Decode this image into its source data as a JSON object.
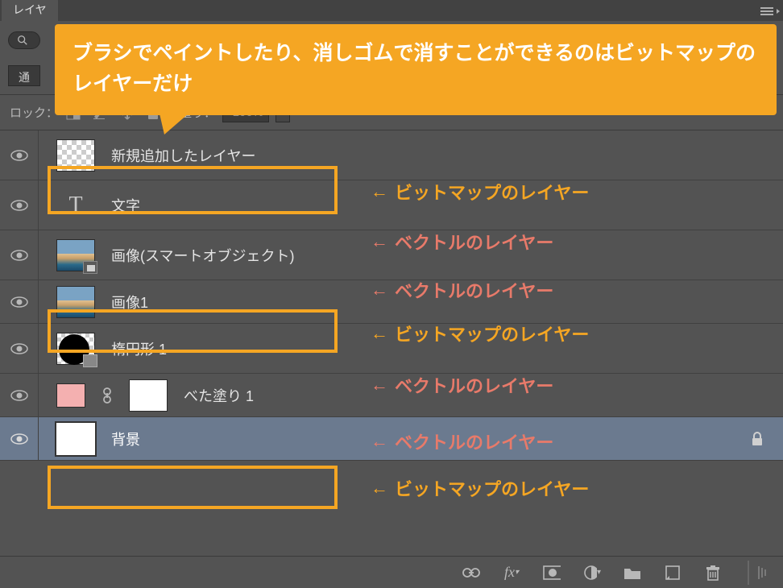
{
  "panel": {
    "tab": "レイヤ"
  },
  "callout": "ブラシでペイントしたり、消しゴムで消すことができるのはビットマップのレイヤーだけ",
  "toolbar": {
    "blend_mode": "通",
    "lock_label": "ロック：",
    "fill_label": "塗り：",
    "fill_value": "100%"
  },
  "layers": [
    {
      "name": "新規追加したレイヤー",
      "type": "bitmap",
      "thumb": "transparent"
    },
    {
      "name": "文字",
      "type": "vector",
      "thumb": "text"
    },
    {
      "name": "画像(スマートオブジェクト)",
      "type": "vector",
      "thumb": "smartimage"
    },
    {
      "name": "画像1",
      "type": "bitmap",
      "thumb": "image"
    },
    {
      "name": "楕円形 1",
      "type": "vector",
      "thumb": "shape"
    },
    {
      "name": "べた塗り 1",
      "type": "vector",
      "thumb": "fill"
    },
    {
      "name": "背景",
      "type": "bitmap",
      "thumb": "bg",
      "locked": true,
      "selected": true
    }
  ],
  "annotations": {
    "bitmap": "ビットマップのレイヤー",
    "vector": "ベクトルのレイヤー",
    "arrow": "←"
  }
}
